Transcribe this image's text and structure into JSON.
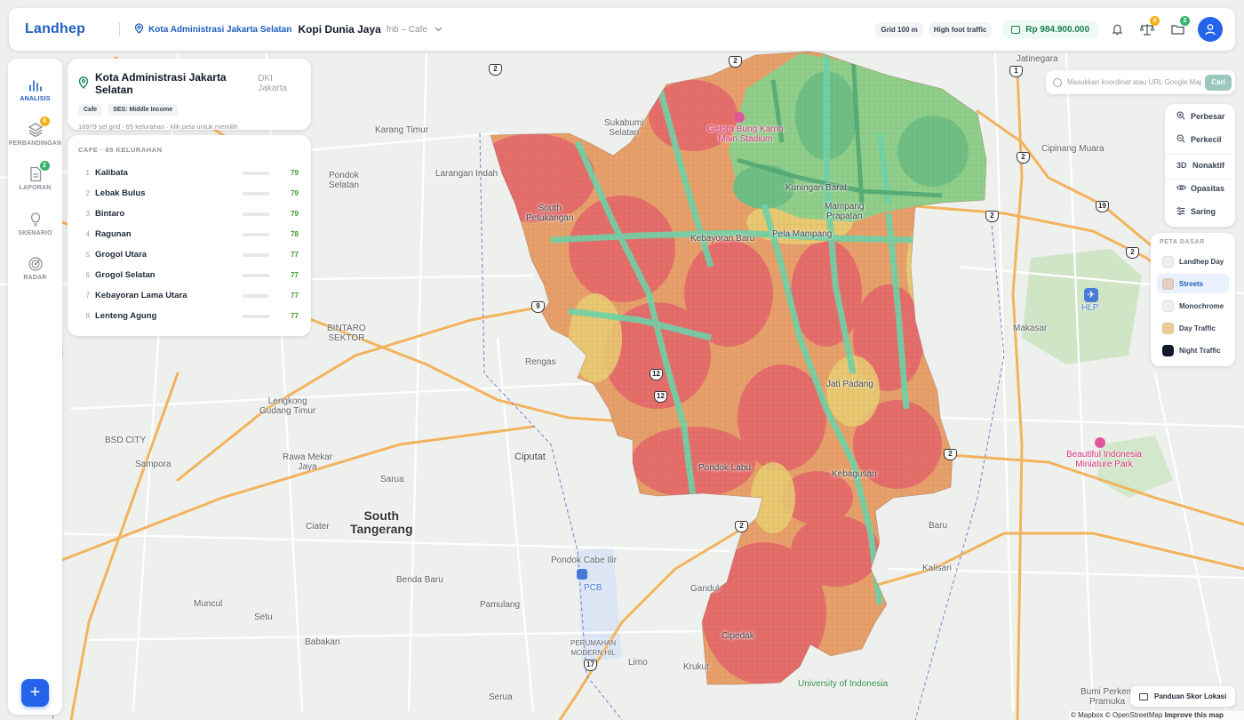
{
  "topbar": {
    "brand": "Landhep",
    "location": "Kota Administrasi Jakarta Selatan",
    "project": "Kopi Dunia Jaya",
    "category": "fnb – Cafe",
    "chips": [
      "Grid 100 m",
      "High foot traffic"
    ],
    "balance": "Rp 984.900.000",
    "compare_badge": "4",
    "folder_badge": "2",
    "icons": {
      "location": "map-pin-icon",
      "chevron": "chevron-down-icon",
      "wallet": "wallet-icon",
      "bell": "bell-icon",
      "compare": "scale-icon",
      "folder": "folder-icon",
      "user": "user-icon"
    }
  },
  "rail": {
    "items": [
      {
        "label": "ANALISIS",
        "icon": "bar-chart-icon",
        "active": true,
        "badge": ""
      },
      {
        "label": "PERBANDINGAN",
        "icon": "layers-icon",
        "active": false,
        "badge": "4"
      },
      {
        "label": "LAPORAN",
        "icon": "document-icon",
        "active": false,
        "badge": "2"
      },
      {
        "label": "SKENARIO",
        "icon": "lightbulb-icon",
        "active": false,
        "badge": ""
      },
      {
        "label": "RADAR",
        "icon": "radar-icon",
        "active": false,
        "badge": ""
      }
    ],
    "fab_label": "+"
  },
  "info_card": {
    "title": "Kota Administrasi Jakarta Selatan",
    "province": "DKI Jakarta",
    "chips": [
      "Cafe",
      "SES: Middle Income"
    ],
    "meta": "16979 sel grid · 65 kelurahan · klik peta untuk memilih"
  },
  "ranking": {
    "header": "CAFE · 65 KELURAHAN",
    "items": [
      {
        "rank": "1",
        "name": "Kalibata",
        "score": "79",
        "fill": 0.79
      },
      {
        "rank": "2",
        "name": "Lebak Bulus",
        "score": "79",
        "fill": 0.79
      },
      {
        "rank": "3",
        "name": "Bintaro",
        "score": "79",
        "fill": 0.79
      },
      {
        "rank": "4",
        "name": "Ragunan",
        "score": "78",
        "fill": 0.78
      },
      {
        "rank": "5",
        "name": "Grogol Utara",
        "score": "77",
        "fill": 0.77
      },
      {
        "rank": "6",
        "name": "Grogol Selatan",
        "score": "77",
        "fill": 0.77
      },
      {
        "rank": "7",
        "name": "Kebayoran Lama Utara",
        "score": "77",
        "fill": 0.77
      },
      {
        "rank": "8",
        "name": "Lenteng Agung",
        "score": "77",
        "fill": 0.77
      }
    ]
  },
  "search": {
    "placeholder": "Masukkan koordinat atau URL Google Maps",
    "button": "Cari"
  },
  "map_controls": [
    {
      "label": "Perbesar",
      "icon": "zoom-in-icon"
    },
    {
      "label": "Perkecil",
      "icon": "zoom-out-icon"
    },
    {
      "label": "Nonaktif",
      "icon": "3d-icon",
      "icon_text": "3D"
    },
    {
      "label": "Opasitas",
      "icon": "eye-icon"
    },
    {
      "label": "Saring",
      "icon": "filter-icon"
    }
  ],
  "basemap": {
    "header": "PETA DASAR",
    "options": [
      {
        "label": "Landhep Day",
        "swatch": "#eeeeee",
        "active": false
      },
      {
        "label": "Streets",
        "swatch": "#e8cfc2",
        "active": true
      },
      {
        "label": "Monochrome",
        "swatch": "#f1f1f1",
        "active": false
      },
      {
        "label": "Day Traffic",
        "swatch": "#e9cf97",
        "active": false
      },
      {
        "label": "Night Traffic",
        "swatch": "#111827",
        "active": false
      }
    ]
  },
  "guide": {
    "label": "Panduan Skor Lokasi",
    "icon": "book-icon"
  },
  "attribution": {
    "mapbox": "© Mapbox",
    "osm": "© OpenStreetMap",
    "improve": "Improve this map"
  },
  "map_labels": {
    "karang_timur": "Karang Timur",
    "sukabumi_selatan": "Sukabumi\nSelatan",
    "gbk": "Gelora Bung Karno\nMain Stadium",
    "jatinegara": "Jatinegara",
    "cipinang_muara": "Cipinang Muara",
    "pondok_selatan": "Pondok\nSelatan",
    "larangan_indah": "Larangan Indah",
    "south_petukangan": "South\nPetukangan",
    "kuningan_barat": "Kuningan Barat",
    "mampang_prapatan": "Mampang\nPrapatan",
    "kebayoran_baru": "Kebayoran Baru",
    "pela_mampang": "Pela Mampang",
    "bintaro_sektor": "BINTARO\nSEKTOR",
    "rengas": "Rengas",
    "jati_padang": "Jati Padang",
    "makasar": "Makasar",
    "hlp": "HLP",
    "lengkong": "Lengkong\nGudang Timur",
    "bsd_city": "BSD CITY",
    "sampora": "Sampora",
    "rawa_mekar": "Rawa Mekar\nJaya",
    "ciputat": "Ciputat",
    "pondok_labu": "Pondok Labu",
    "kebagusan": "Kebagusan",
    "sarua": "Sarua",
    "tmii": "Beautiful Indonesia\nMiniature Park",
    "south_tangerang": "South\nTangerang",
    "ciater": "Ciater",
    "baru": "Baru",
    "pondok_cabe": "Pondok Cabe Ilir",
    "pcb": "PCB",
    "benda_baru": "Benda Baru",
    "muncul": "Muncul",
    "pamulang": "Pamulang",
    "gandul": "Gandul",
    "kalisari": "Kalisari",
    "setu": "Setu",
    "cipedak": "Cipedak",
    "babakan": "Babakan",
    "perumahan": "PERUMAHAN\nMODERN HIL",
    "limo": "Limo",
    "krukut": "Krukut",
    "ui": "University of Indonesia",
    "serua": "Serua",
    "bumi_perkemahan": "Bumi Perkem\nPramuka"
  },
  "road_shields": [
    "2",
    "1",
    "2",
    "2",
    "19",
    "9",
    "12",
    "12",
    "2",
    "2",
    "17"
  ]
}
